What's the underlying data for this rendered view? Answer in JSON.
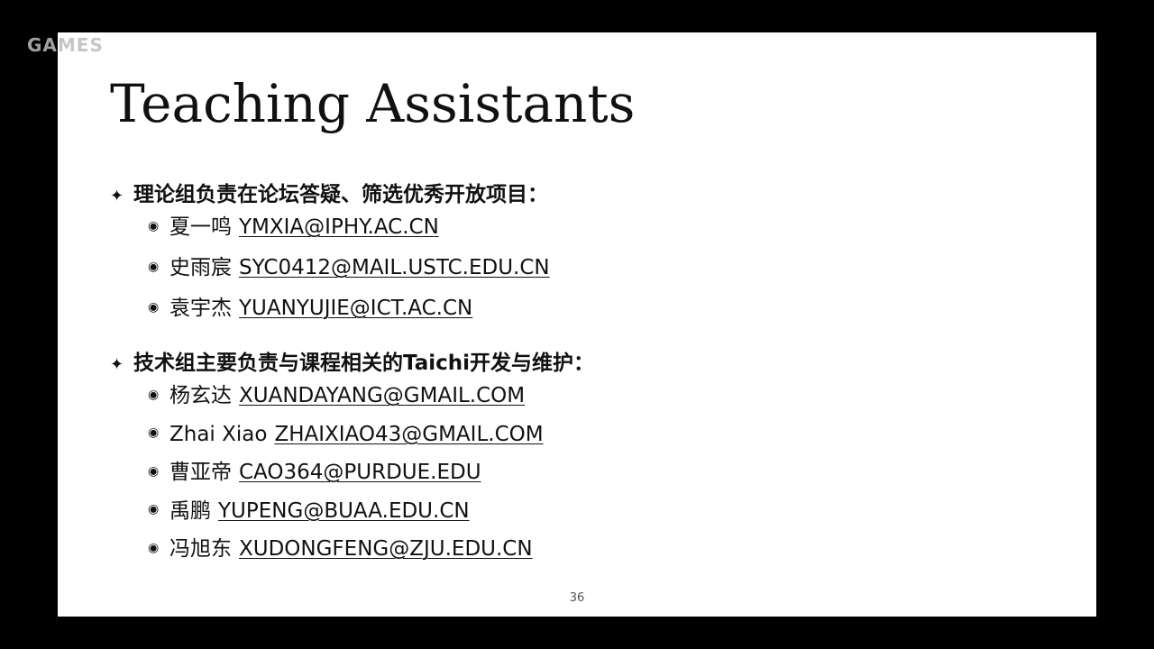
{
  "watermark": "GAMES",
  "slide": {
    "title": "Teaching Assistants",
    "bullet_glyph": "✦",
    "item_glyph": "◉",
    "sections": [
      {
        "heading": "理论组负责在论坛答疑、筛选优秀开放项目：",
        "members": [
          {
            "name": "夏一鸣",
            "email": "YMXIA@IPHY.AC.CN"
          },
          {
            "name": "史雨宸",
            "email": "SYC0412@MAIL.USTC.EDU.CN"
          },
          {
            "name": "袁宇杰",
            "email": "YUANYUJIE@ICT.AC.CN"
          }
        ]
      },
      {
        "heading": "技术组主要负责与课程相关的Taichi开发与维护：",
        "members": [
          {
            "name": "杨玄达",
            "email": "XUANDAYANG@GMAIL.COM"
          },
          {
            "name": "Zhai Xiao",
            "email": "ZHAIXIAO43@GMAIL.COM"
          },
          {
            "name": "曹亚帝",
            "email": "CAO364@PURDUE.EDU"
          },
          {
            "name": "禹鹏",
            "email": "YUPENG@BUAA.EDU.CN"
          },
          {
            "name": "冯旭东",
            "email": "XUDONGFENG@ZJU.EDU.CN"
          }
        ]
      }
    ],
    "page_number": "36"
  }
}
